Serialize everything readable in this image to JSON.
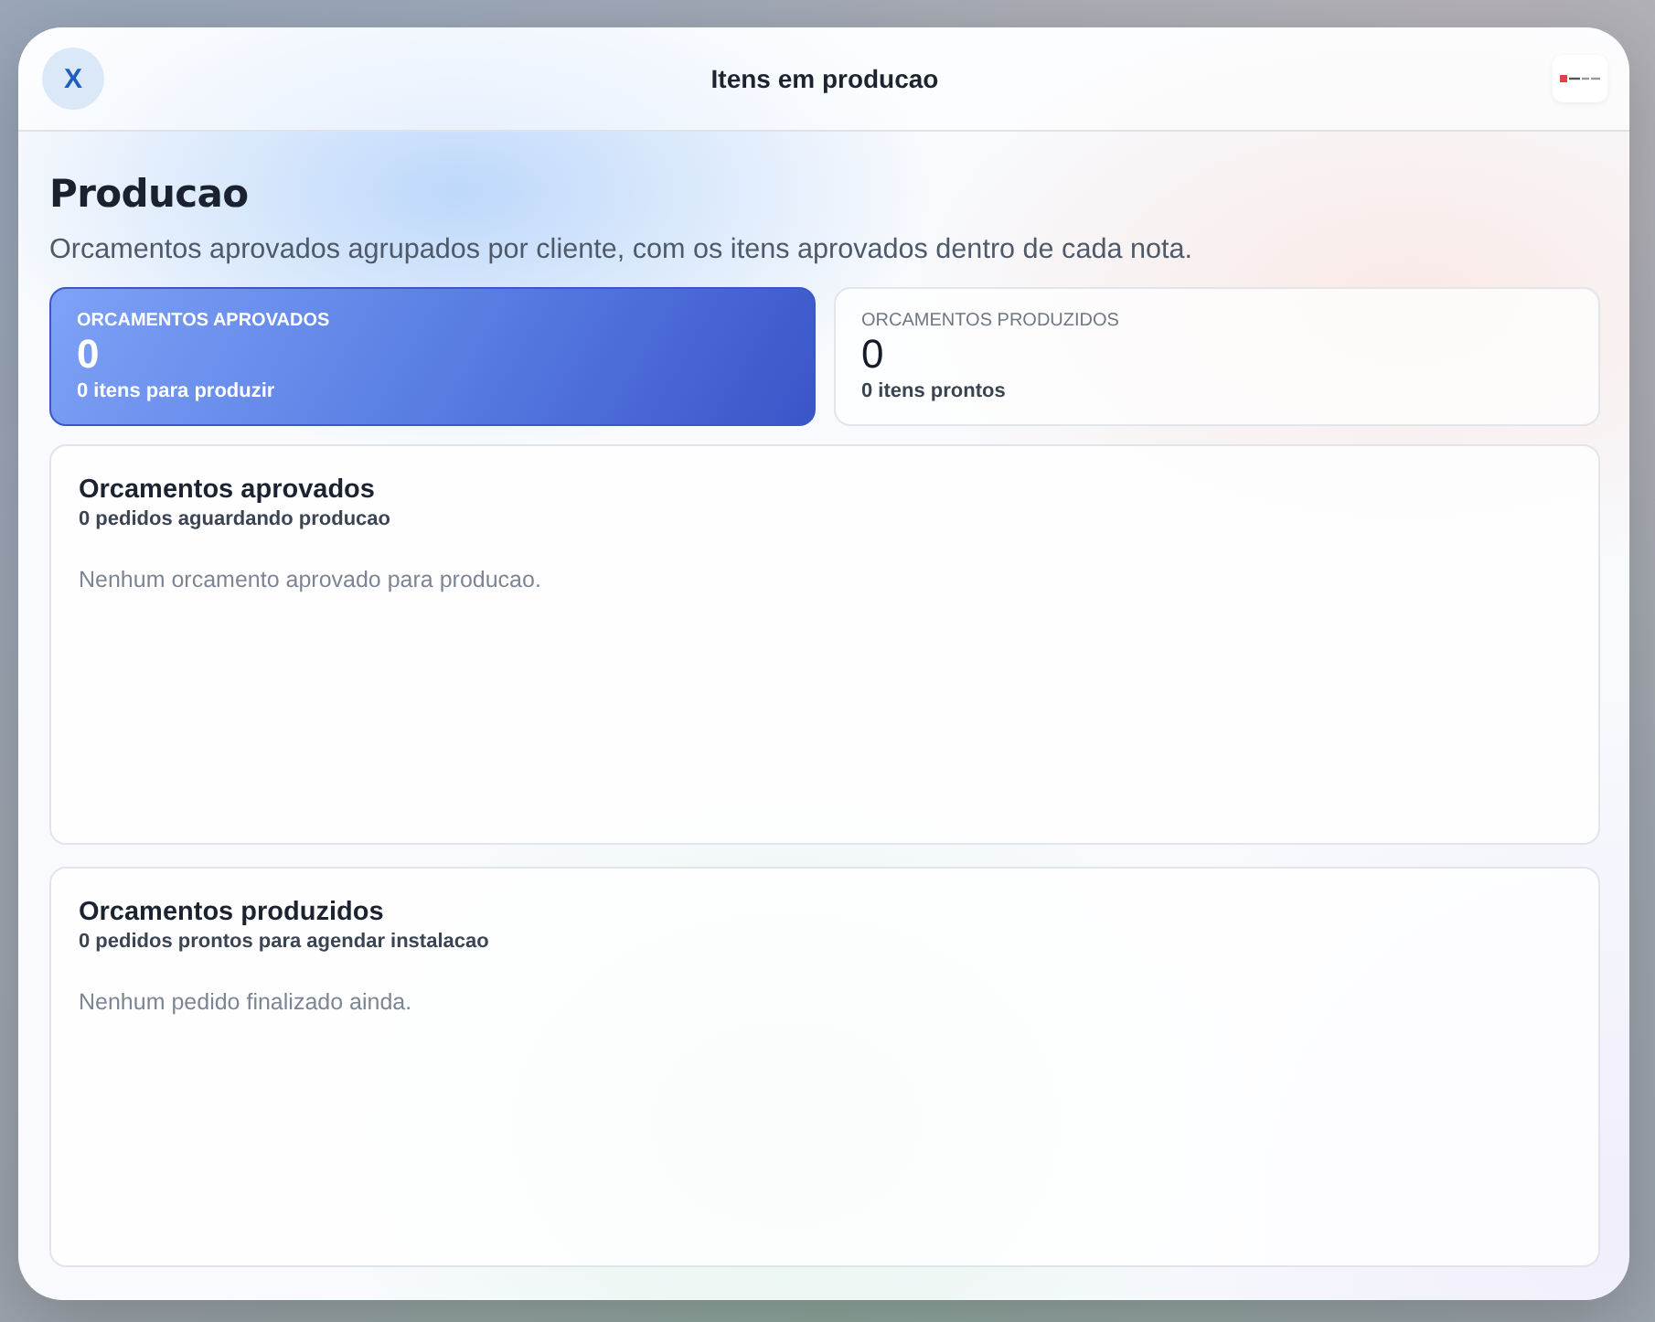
{
  "window": {
    "title": "Itens em producao",
    "close_label": "X"
  },
  "page": {
    "heading": "Producao",
    "subtitle": "Orcamentos aprovados agrupados por cliente, com os itens aprovados dentro de cada nota."
  },
  "stats": [
    {
      "kind": "highlight",
      "label": "ORCAMENTOS APROVADOS",
      "value": "0",
      "detail": "0 itens para produzir"
    },
    {
      "kind": "plain",
      "label": "ORCAMENTOS PRODUZIDOS",
      "value": "0",
      "detail": "0 itens prontos"
    }
  ],
  "sections": [
    {
      "title": "Orcamentos aprovados",
      "summary": "0 pedidos aguardando producao",
      "empty_message": "Nenhum orcamento aprovado para producao."
    },
    {
      "title": "Orcamentos produzidos",
      "summary": "0 pedidos prontos para agendar instalacao",
      "empty_message": "Nenhum pedido finalizado ainda."
    }
  ]
}
